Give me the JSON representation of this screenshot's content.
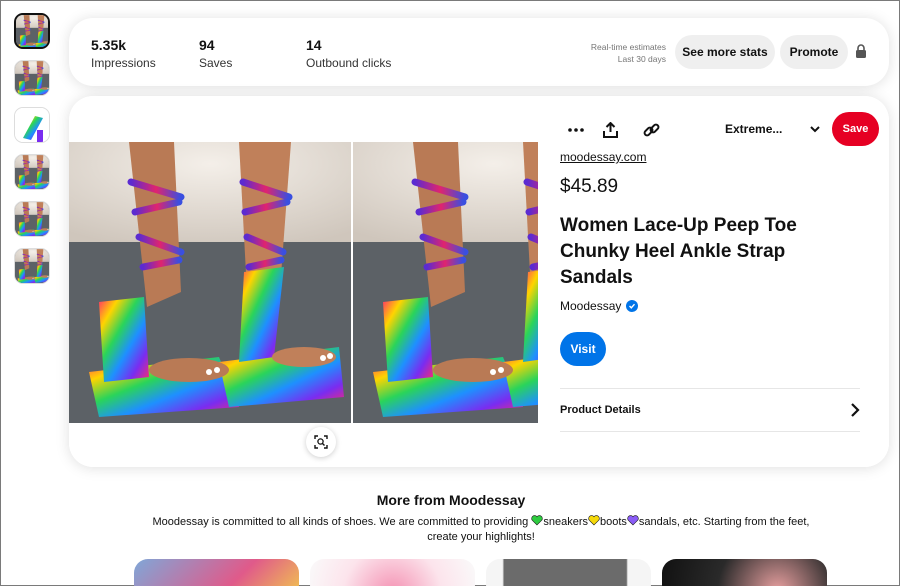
{
  "thumbnails": [
    {
      "name": "thumb-1",
      "active": true
    },
    {
      "name": "thumb-2",
      "active": false
    },
    {
      "name": "thumb-3",
      "active": false
    },
    {
      "name": "thumb-4",
      "active": false
    },
    {
      "name": "thumb-5",
      "active": false
    },
    {
      "name": "thumb-6",
      "active": false
    }
  ],
  "stats": {
    "impressions_value": "5.35k",
    "impressions_label": "Impressions",
    "saves_value": "94",
    "saves_label": "Saves",
    "clicks_value": "14",
    "clicks_label": "Outbound clicks",
    "estimate_line1": "Real-time estimates",
    "estimate_line2": "Last 30 days",
    "see_more_label": "See more stats",
    "promote_label": "Promote"
  },
  "pin": {
    "board_label": "Extreme...",
    "save_label": "Save",
    "domain": "moodessay.com",
    "price": "$45.89",
    "title": "Women Lace-Up Peep Toe Chunky Heel Ankle Strap Sandals",
    "seller": "Moodessay",
    "visit_label": "Visit",
    "details_label": "Product Details"
  },
  "more": {
    "title": "More from  Moodessay",
    "desc_part1": "Moodessay is committed to all kinds of shoes. We are committed to providing ",
    "desc_sneakers": "sneakers",
    "desc_boots": "boots",
    "desc_part2": "sandals, etc. Starting from the feet, create your highlights!"
  },
  "colors": {
    "save_red": "#e60023",
    "visit_blue": "#0074e8",
    "pill_gray": "#efefef",
    "heart_green": "#2ecc40",
    "heart_yellow": "#f5d90a",
    "heart_purple": "#8a5cf6"
  },
  "icons": {
    "more": "ellipsis-icon",
    "share": "share-icon",
    "link": "link-icon",
    "chevron": "chevron-down-icon",
    "lock": "lock-icon",
    "zoom": "visual-search-icon",
    "arrow": "chevron-right-icon",
    "verified": "verified-badge-icon"
  }
}
